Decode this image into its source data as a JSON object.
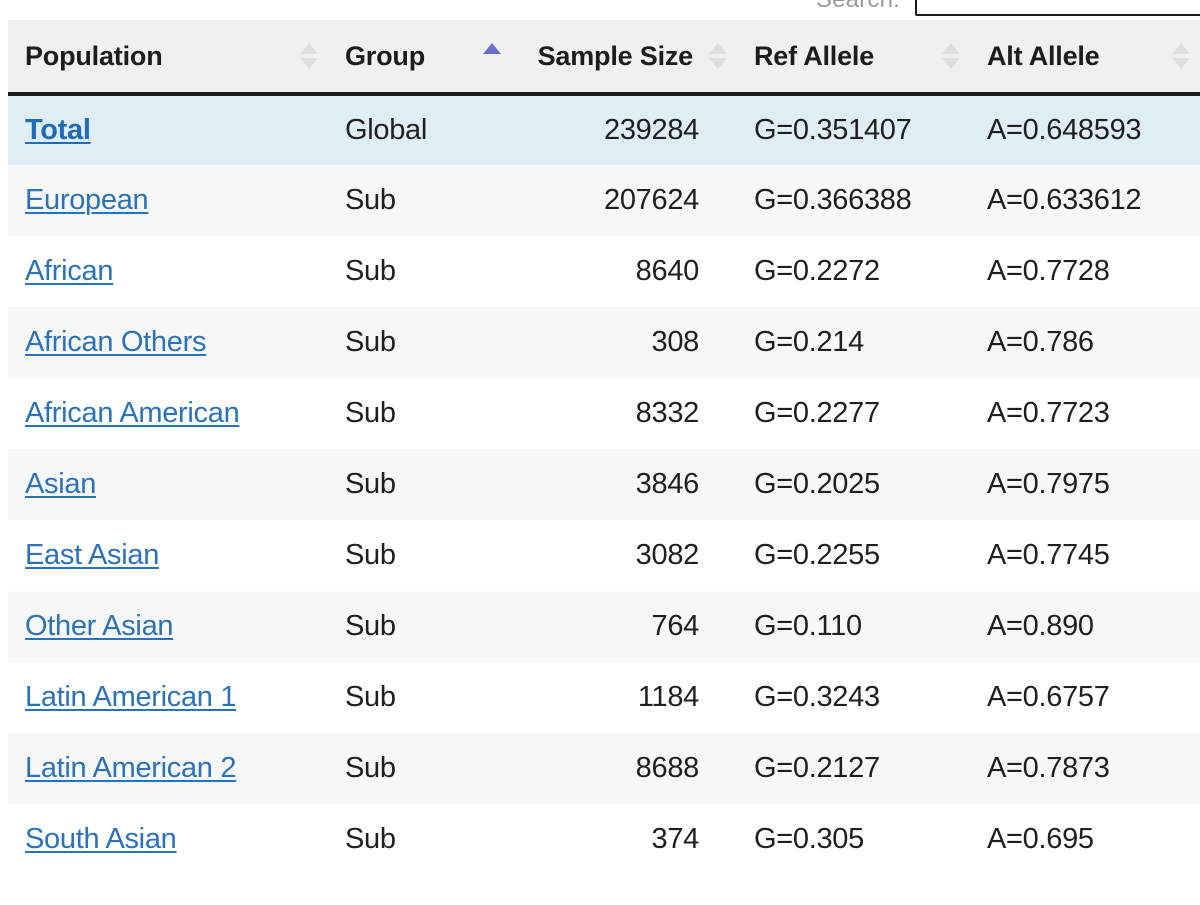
{
  "search": {
    "label": "Search:",
    "value": "",
    "placeholder": ""
  },
  "table": {
    "columns": [
      {
        "label": "Population",
        "align": "left",
        "sort": "none"
      },
      {
        "label": "Group",
        "align": "left",
        "sort": "asc"
      },
      {
        "label": "Sample Size",
        "align": "right",
        "sort": "none"
      },
      {
        "label": "Ref Allele",
        "align": "left",
        "sort": "none"
      },
      {
        "label": "Alt Allele",
        "align": "left",
        "sort": "none"
      }
    ],
    "rows": [
      {
        "population": "Total",
        "group": "Global",
        "sample_size": "239284",
        "ref_allele": "G=0.351407",
        "alt_allele": "A=0.648593",
        "selected": true
      },
      {
        "population": "European",
        "group": "Sub",
        "sample_size": "207624",
        "ref_allele": "G=0.366388",
        "alt_allele": "A=0.633612",
        "selected": false
      },
      {
        "population": "African",
        "group": "Sub",
        "sample_size": "8640",
        "ref_allele": "G=0.2272",
        "alt_allele": "A=0.7728",
        "selected": false
      },
      {
        "population": "African Others",
        "group": "Sub",
        "sample_size": "308",
        "ref_allele": "G=0.214",
        "alt_allele": "A=0.786",
        "selected": false
      },
      {
        "population": "African American",
        "group": "Sub",
        "sample_size": "8332",
        "ref_allele": "G=0.2277",
        "alt_allele": "A=0.7723",
        "selected": false
      },
      {
        "population": "Asian",
        "group": "Sub",
        "sample_size": "3846",
        "ref_allele": "G=0.2025",
        "alt_allele": "A=0.7975",
        "selected": false
      },
      {
        "population": "East Asian",
        "group": "Sub",
        "sample_size": "3082",
        "ref_allele": "G=0.2255",
        "alt_allele": "A=0.7745",
        "selected": false
      },
      {
        "population": "Other Asian",
        "group": "Sub",
        "sample_size": "764",
        "ref_allele": "G=0.110",
        "alt_allele": "A=0.890",
        "selected": false
      },
      {
        "population": "Latin American 1",
        "group": "Sub",
        "sample_size": "1184",
        "ref_allele": "G=0.3243",
        "alt_allele": "A=0.6757",
        "selected": false
      },
      {
        "population": "Latin American 2",
        "group": "Sub",
        "sample_size": "8688",
        "ref_allele": "G=0.2127",
        "alt_allele": "A=0.7873",
        "selected": false
      },
      {
        "population": "South Asian",
        "group": "Sub",
        "sample_size": "374",
        "ref_allele": "G=0.305",
        "alt_allele": "A=0.695",
        "selected": false
      }
    ]
  },
  "icons": {
    "sort_inactive": "sort-both-icon",
    "sort_ascending": "sort-asc-icon"
  },
  "colors": {
    "header_bg": "#f0f0f0",
    "header_border": "#1c1c1c",
    "row_stripe": "#f7f7f7",
    "row_selected": "#dfeef5",
    "link": "#2c72b8",
    "sort_active": "#6a6dd2",
    "sort_inactive": "#dedede"
  }
}
